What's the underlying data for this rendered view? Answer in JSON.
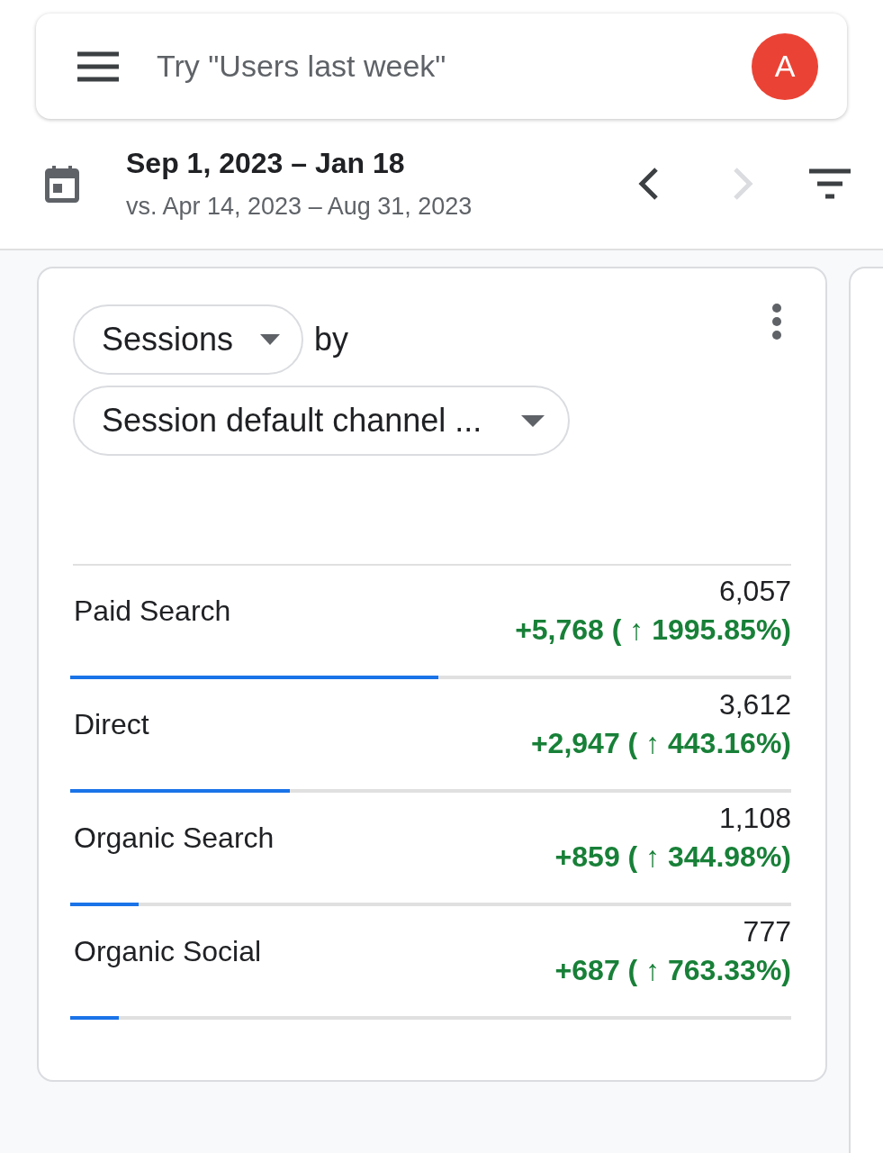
{
  "search": {
    "placeholder": "Try \"Users last week\""
  },
  "avatar": {
    "initial": "A"
  },
  "date_range": {
    "current": "Sep 1, 2023 – Jan 18",
    "comparison": "vs. Apr 14, 2023 – Aug 31, 2023",
    "prev_disabled": false,
    "next_disabled": true
  },
  "card": {
    "metric": "Sessions",
    "connector": "by",
    "dimension": "Session default channel ...",
    "rows": [
      {
        "label": "Paid Search",
        "value": "6,057",
        "change": "+5,768 ( ↑ 1995.85%)",
        "increase": true,
        "level": 0.51
      },
      {
        "label": "Direct",
        "value": "3,612",
        "change": "+2,947 ( ↑ 443.16%)",
        "increase": true,
        "level": 0.305
      },
      {
        "label": "Organic Search",
        "value": "1,108",
        "change": "+859 ( ↑ 344.98%)",
        "increase": true,
        "level": 0.095
      },
      {
        "label": "Organic Social",
        "value": "777",
        "change": "+687 ( ↑ 763.33%)",
        "increase": true,
        "level": 0.068
      }
    ]
  }
}
